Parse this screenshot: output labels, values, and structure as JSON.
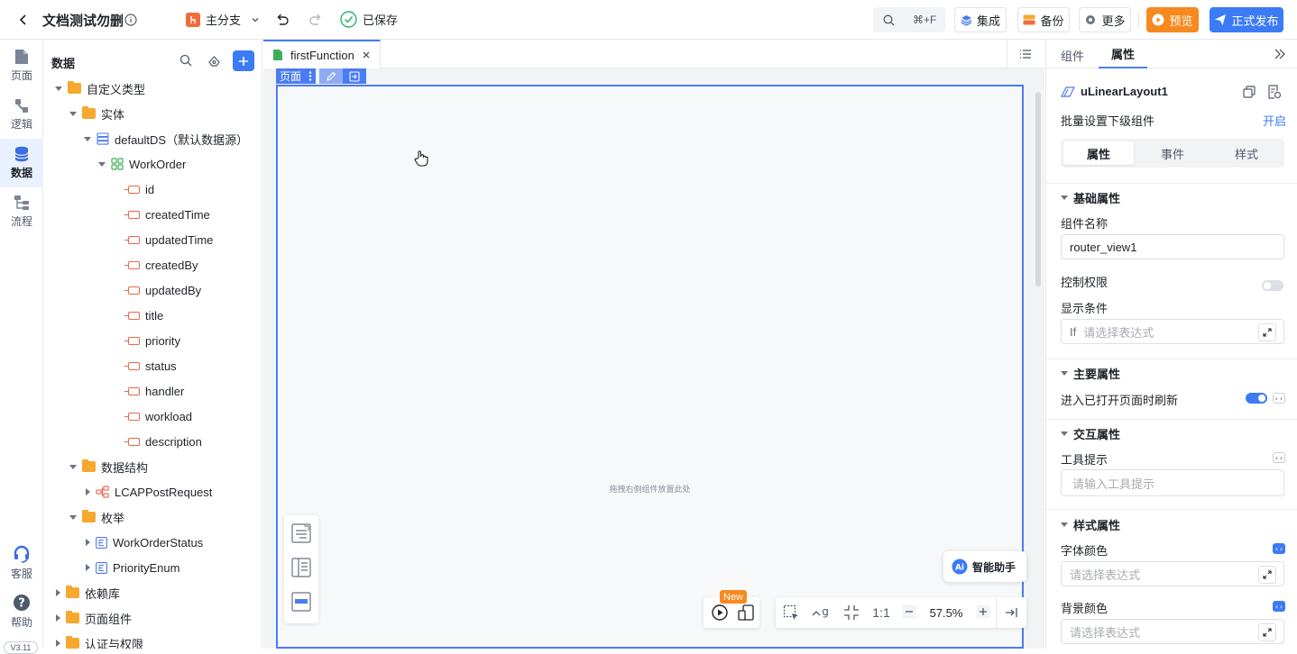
{
  "header": {
    "project_title": "文档测试勿删",
    "branch": "主分支",
    "save_status": "已保存",
    "search_shortcut": "⌘+F",
    "integrate": "集成",
    "backup": "备份",
    "more": "更多",
    "preview": "预览",
    "publish": "正式发布"
  },
  "leftnav": {
    "items": [
      {
        "label": "页面"
      },
      {
        "label": "逻辑"
      },
      {
        "label": "数据"
      },
      {
        "label": "流程"
      }
    ],
    "service": "客服",
    "help": "帮助",
    "version": "V3.11"
  },
  "tree": {
    "title": "数据",
    "nodes": [
      {
        "label": "自定义类型"
      },
      {
        "label": "实体"
      },
      {
        "label": "defaultDS（默认数据源）"
      },
      {
        "label": "WorkOrder"
      },
      {
        "label": "id"
      },
      {
        "label": "createdTime"
      },
      {
        "label": "updatedTime"
      },
      {
        "label": "createdBy"
      },
      {
        "label": "updatedBy"
      },
      {
        "label": "title"
      },
      {
        "label": "priority"
      },
      {
        "label": "status"
      },
      {
        "label": "handler"
      },
      {
        "label": "workload"
      },
      {
        "label": "description"
      },
      {
        "label": "数据结构"
      },
      {
        "label": "LCAPPostRequest"
      },
      {
        "label": "枚举"
      },
      {
        "label": "WorkOrderStatus"
      },
      {
        "label": "PriorityEnum"
      },
      {
        "label": "依赖库"
      },
      {
        "label": "页面组件"
      },
      {
        "label": "认证与权限"
      }
    ]
  },
  "editor": {
    "tab_name": "firstFunction",
    "page_tag": "页面",
    "drop_hint": "拖拽右侧组件放置此处",
    "ai_assistant": "智能助手",
    "new_badge": "New",
    "ratio": "1:1",
    "zoom": "57.5%"
  },
  "panel": {
    "tabs": [
      "组件",
      "属性"
    ],
    "component_name": "uLinearLayout1",
    "batch_label": "批量设置下级组件",
    "batch_action": "开启",
    "subtabs": [
      "属性",
      "事件",
      "样式"
    ],
    "basic_title": "基础属性",
    "name_label": "组件名称",
    "name_value": "router_view1",
    "perm_label": "控制权限",
    "cond_label": "显示条件",
    "if_prefix": "If",
    "expr_placeholder": "请选择表达式",
    "main_title": "主要属性",
    "refresh_label": "进入已打开页面时刷新",
    "interact_title": "交互属性",
    "tooltip_label": "工具提示",
    "tooltip_placeholder": "请输入工具提示",
    "style_title": "样式属性",
    "font_color_label": "字体颜色",
    "bg_color_label": "背景颜色"
  }
}
